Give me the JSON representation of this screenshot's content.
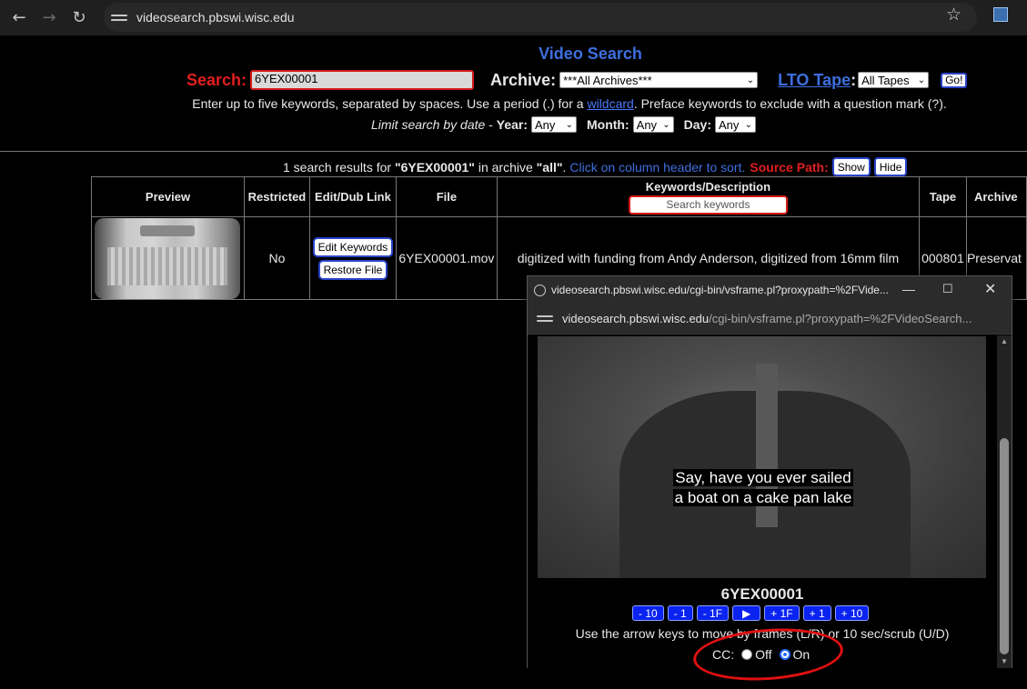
{
  "browser": {
    "url": "videosearch.pbswi.wisc.edu"
  },
  "page": {
    "title": "Video Search",
    "search_label": "Search:",
    "search_value": "6YEX00001",
    "archive_label": "Archive:",
    "archive_selected": "***All Archives***",
    "lto_label": "LTO Tape",
    "lto_colon": ":",
    "lto_selected": "All Tapes",
    "go_label": "Go!",
    "help_before": "Enter up to five keywords, separated by spaces. Use a period (.) for a ",
    "help_link": "wildcard",
    "help_after": ". Preface keywords to exclude with a question mark (?).",
    "limit_text": "Limit search by date",
    "limit_dash": " - ",
    "year_label": "Year:",
    "year_selected": "Any",
    "month_label": "Month:",
    "month_selected": "Any",
    "day_label": "Day:",
    "day_selected": "Any",
    "results_prefix": "1 search results for ",
    "results_query": "\"6YEX00001\"",
    "results_mid": " in archive ",
    "results_archive": "\"all\"",
    "results_end": ".",
    "sort_hint": "Click on column header to sort.",
    "source_path_label": "Source Path:",
    "show_label": "Show",
    "hide_label": "Hide"
  },
  "table": {
    "headers": {
      "preview": "Preview",
      "restricted": "Restricted",
      "edit": "Edit/Dub Link",
      "file": "File",
      "keywords": "Keywords/Description",
      "tape": "Tape",
      "archive": "Archive"
    },
    "keyword_search_placeholder": "Search keywords",
    "rows": [
      {
        "restricted": "No",
        "edit_keywords": "Edit Keywords",
        "restore_file": "Restore File",
        "file": "6YEX00001.mov",
        "description": "digitized with funding from Andy Anderson, digitized from 16mm film",
        "tape": "000801",
        "archive": "Preservat"
      }
    ]
  },
  "popup": {
    "title": "videosearch.pbswi.wisc.edu/cgi-bin/vsframe.pl?proxypath=%2FVide...",
    "address_host": "videosearch.pbswi.wisc.edu",
    "address_path": "/cgi-bin/vsframe.pl?proxypath=%2FVideoSearch...",
    "caption_line1": "Say, have you ever sailed",
    "caption_line2": "a boat on a cake pan lake",
    "video_id": "6YEX00001",
    "controls": [
      "- 10",
      "- 1",
      "- 1F",
      "▶",
      "+ 1F",
      "+ 1",
      "+ 10"
    ],
    "help": "Use the arrow keys to move by frames (L/R) or 10 sec/scrub (U/D)",
    "cc_label": "CC:",
    "cc_off": "Off",
    "cc_on": "On",
    "cc_state": "On"
  },
  "colors": {
    "accent_blue": "#3e6fdf",
    "accent_red": "#e21f1f",
    "button_blue": "#0a23f0",
    "annotation_red": "#e01010"
  }
}
